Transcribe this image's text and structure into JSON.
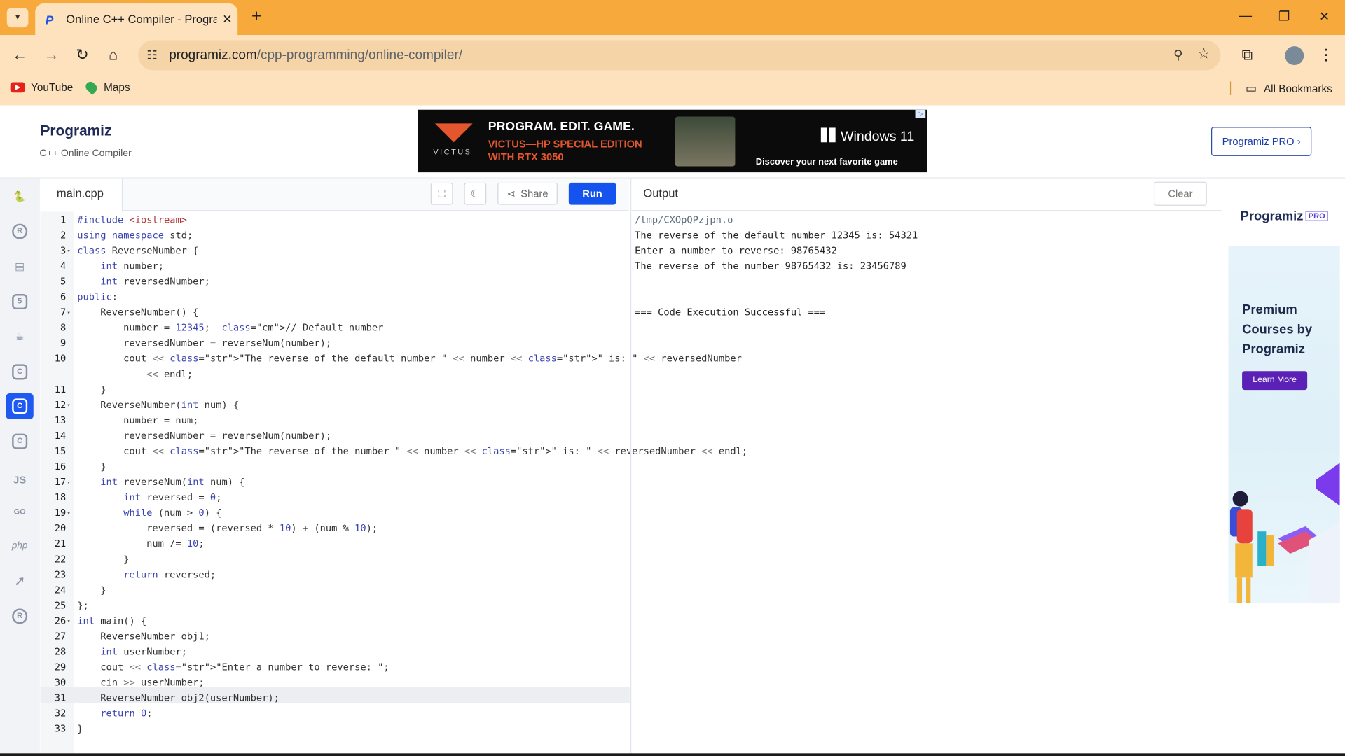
{
  "browser": {
    "tab_title": "Online C++ Compiler - Program",
    "url_host": "programiz.com",
    "url_path": "/cpp-programming/online-compiler/",
    "bookmarks": [
      "YouTube",
      "Maps"
    ],
    "all_bookmarks": "All Bookmarks"
  },
  "site": {
    "logo": "Programiz",
    "logo_sub": "C++ Online Compiler",
    "pro_button": "Programiz PRO ›",
    "ad": {
      "h1": "PROGRAM. EDIT. GAME.",
      "h2a": "VICTUS—HP SPECIAL EDITION",
      "h2b": "WITH RTX 3050",
      "brand": "VICTUS",
      "win": "Windows 11",
      "disc": "Discover your next favorite game"
    }
  },
  "editor": {
    "file": "main.cpp",
    "share": "Share",
    "run": "Run",
    "line_numbers": [
      "1",
      "2",
      "3",
      "4",
      "5",
      "6",
      "7",
      "8",
      "9",
      "10",
      "11",
      "12",
      "13",
      "14",
      "15",
      "16",
      "17",
      "18",
      "19",
      "20",
      "21",
      "22",
      "23",
      "24",
      "25",
      "26",
      "27",
      "28",
      "29",
      "30",
      "31",
      "32",
      "33"
    ],
    "lines": [
      "#include <iostream>",
      "using namespace std;",
      "class ReverseNumber {",
      "    int number;",
      "    int reversedNumber;",
      "public:",
      "    ReverseNumber() {",
      "        number = 12345;  // Default number",
      "        reversedNumber = reverseNum(number);",
      "        cout << \"The reverse of the default number \" << number << \" is: \" << reversedNumber",
      "            << endl;",
      "    }",
      "    ReverseNumber(int num) {",
      "        number = num;",
      "        reversedNumber = reverseNum(number);",
      "        cout << \"The reverse of the number \" << number << \" is: \" << reversedNumber << endl;",
      "    }",
      "    int reverseNum(int num) {",
      "        int reversed = 0;",
      "        while (num > 0) {",
      "            reversed = (reversed * 10) + (num % 10);",
      "            num /= 10;",
      "        }",
      "        return reversed;",
      "    }",
      "};",
      "int main() {",
      "    ReverseNumber obj1;",
      "    int userNumber;",
      "    cout << \"Enter a number to reverse: \";",
      "    cin >> userNumber;",
      "    ReverseNumber obj2(userNumber);",
      "    return 0;",
      "}"
    ]
  },
  "output": {
    "title": "Output",
    "clear": "Clear",
    "lines": [
      "/tmp/CXOpQPzjpn.o",
      "The reverse of the default number 12345 is: 54321",
      "Enter a number to reverse: 98765432",
      "The reverse of the number 98765432 is: 23456789",
      "",
      "",
      "=== Code Execution Successful ==="
    ]
  },
  "right_ad": {
    "logo": "Programiz",
    "pro": "PRO",
    "headline": "Premium Courses by Programiz",
    "cta": "Learn More"
  },
  "sidebar_langs": [
    "python-icon",
    "r-icon",
    "sql-icon",
    "html-icon",
    "java-icon",
    "c-icon",
    "cpp-icon",
    "csharp-icon",
    "js-icon",
    "go-icon",
    "php-icon",
    "swift-icon",
    "rust-icon"
  ],
  "sidebar_text": {
    "js": "JS",
    "go": "GO",
    "php": "php"
  },
  "colors": {
    "tabstrip": "#f7aa3b",
    "toolbar": "#fde2bd",
    "run": "#1553ef",
    "active_lang": "#1e5af2"
  }
}
